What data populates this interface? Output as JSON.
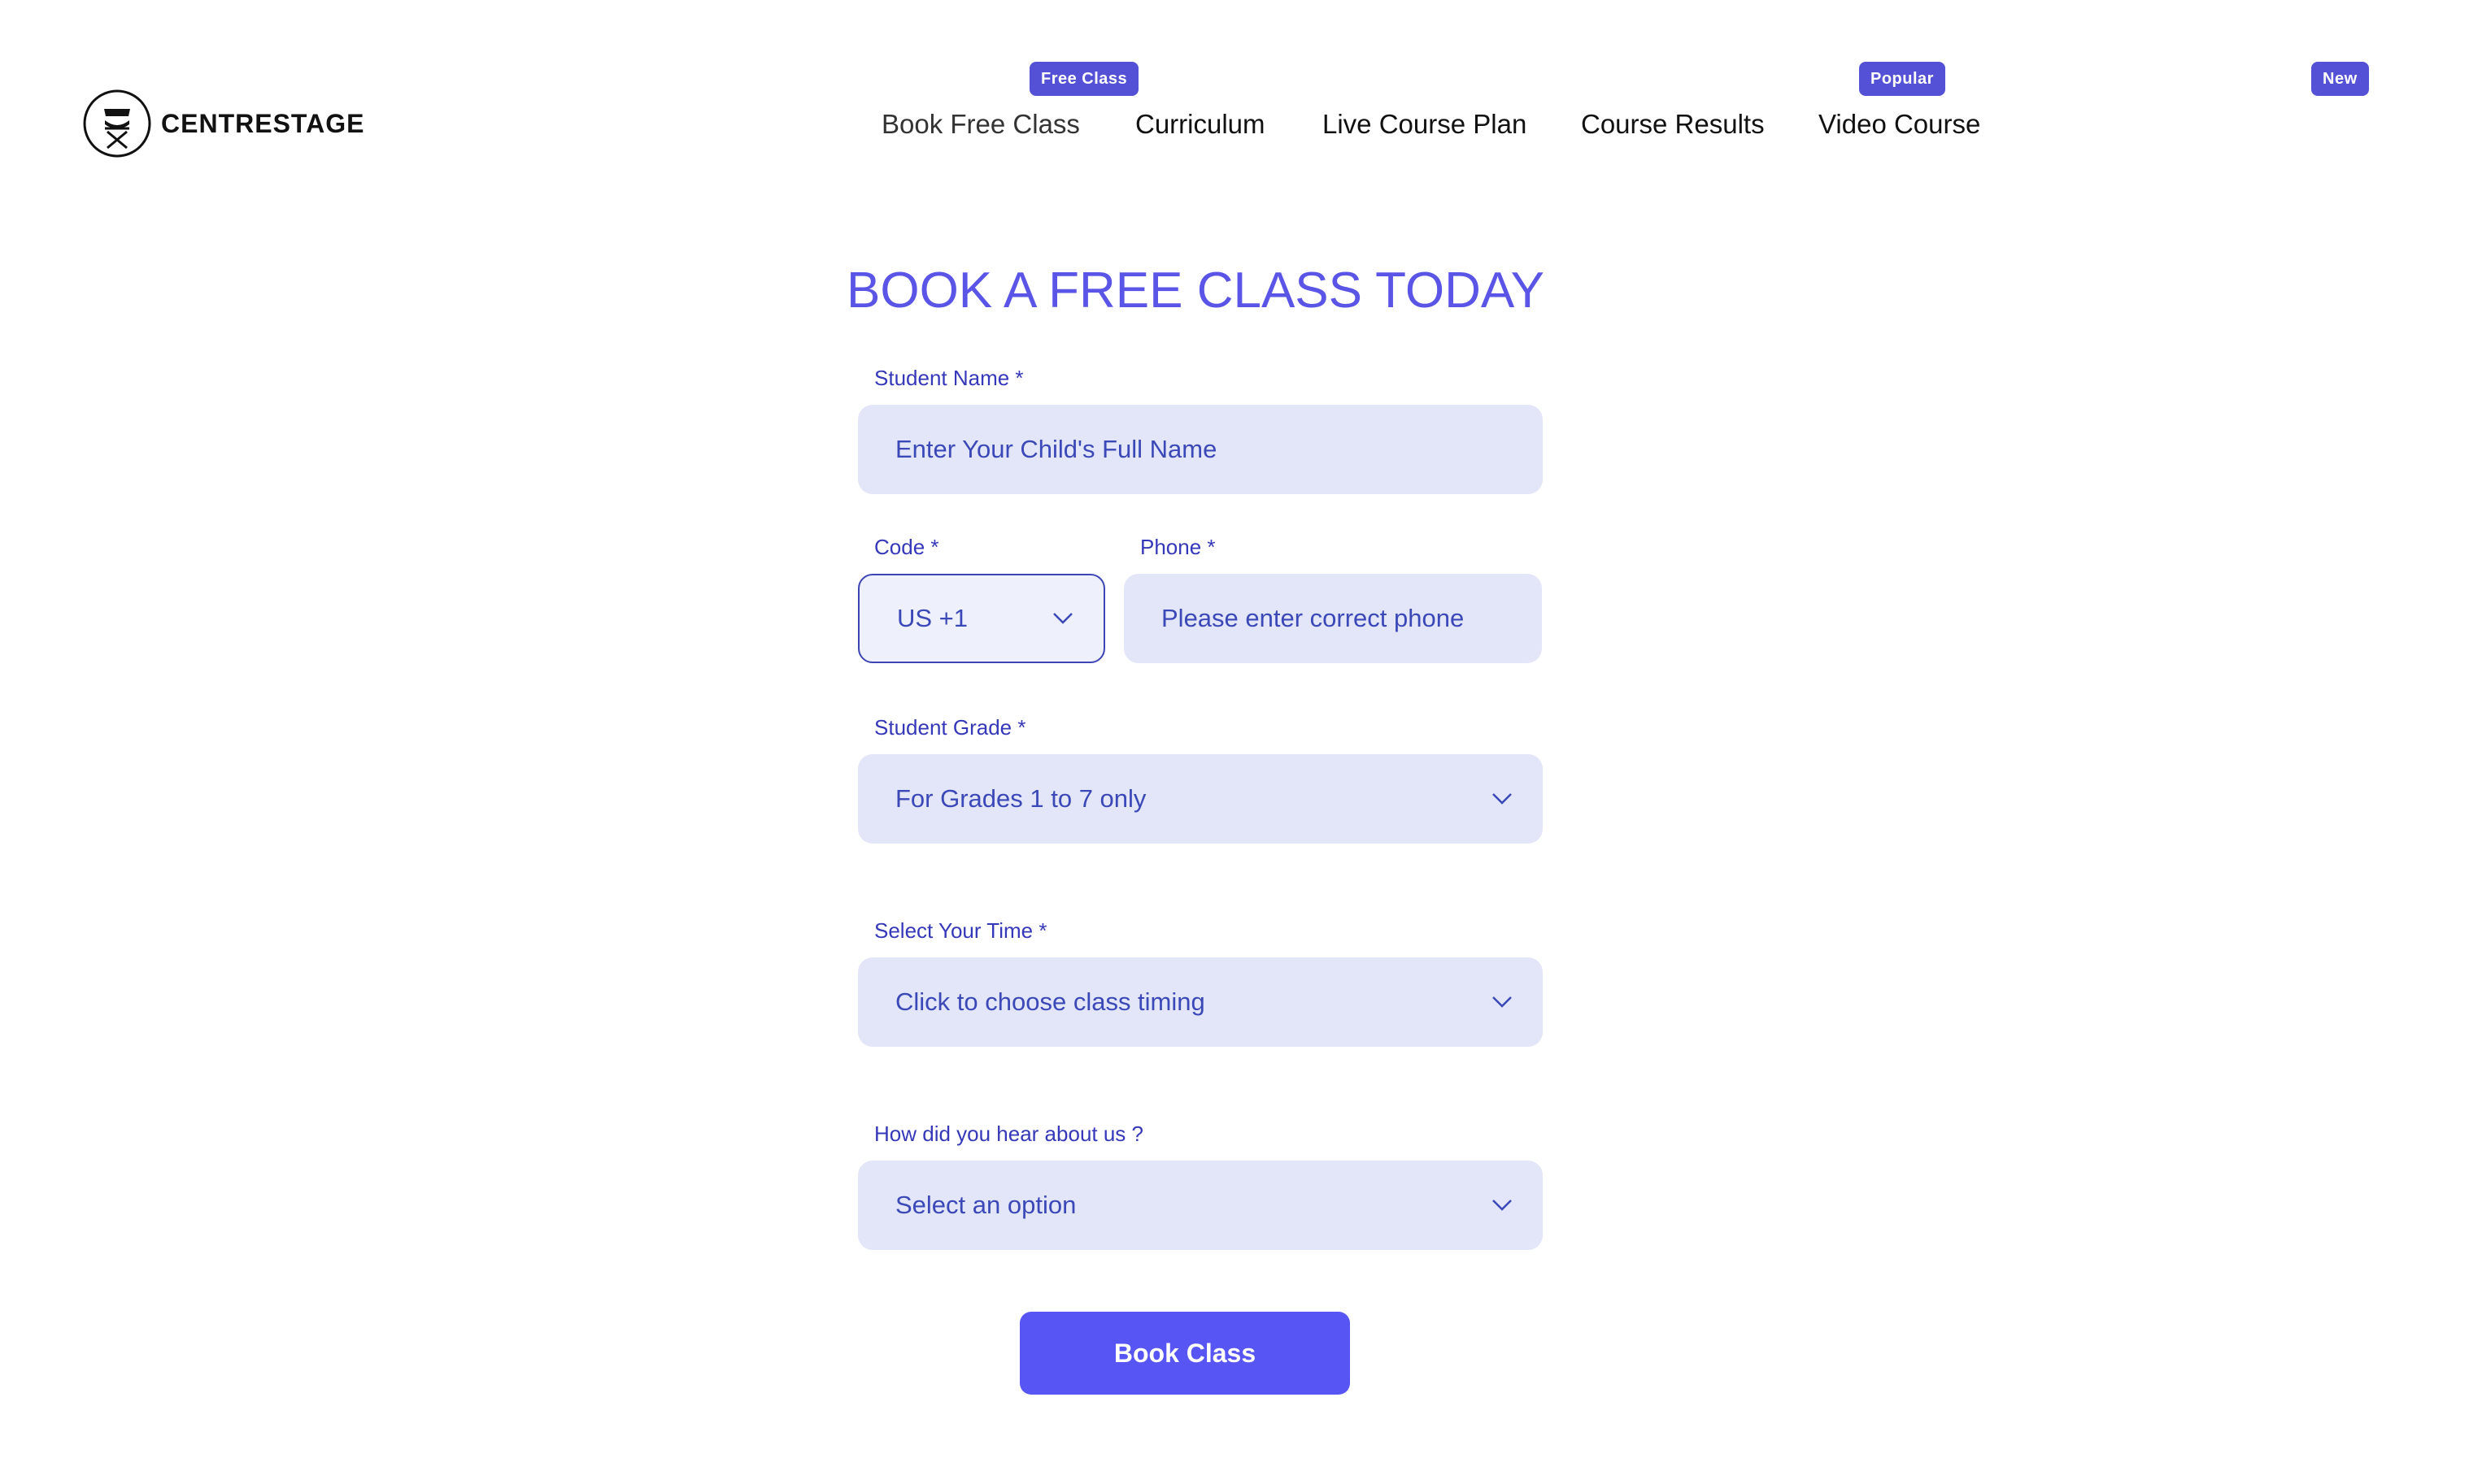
{
  "brand": {
    "name": "CENTRESTAGE",
    "logo_icon": "director-chair-icon"
  },
  "nav": {
    "items": [
      {
        "label": "Book Free Class",
        "badge": "Free Class"
      },
      {
        "label": "Curriculum"
      },
      {
        "label": "Live Course Plan"
      },
      {
        "label": "Course Results"
      },
      {
        "label": "Video Course",
        "badge": "Popular"
      }
    ],
    "extra_badge": "New"
  },
  "form": {
    "title": "BOOK A FREE CLASS TODAY",
    "student_name": {
      "label": "Student Name *",
      "placeholder": "Enter Your Child's Full Name"
    },
    "code": {
      "label": "Code *",
      "value": "US +1"
    },
    "phone": {
      "label": "Phone *",
      "placeholder": "Please enter correct phone"
    },
    "grade": {
      "label": "Student Grade *",
      "value": "For Grades 1 to 7 only"
    },
    "time": {
      "label": "Select Your Time *",
      "value": "Click to choose class timing"
    },
    "source": {
      "label": "How did you hear about us ?",
      "value": "Select an option"
    },
    "submit_label": "Book Class"
  },
  "colors": {
    "accent": "#5855f5",
    "badge": "#5451d6",
    "title": "#5a55e6",
    "label": "#3538b8",
    "field_bg": "#e3e6f8",
    "field_text": "#3a48b8"
  }
}
